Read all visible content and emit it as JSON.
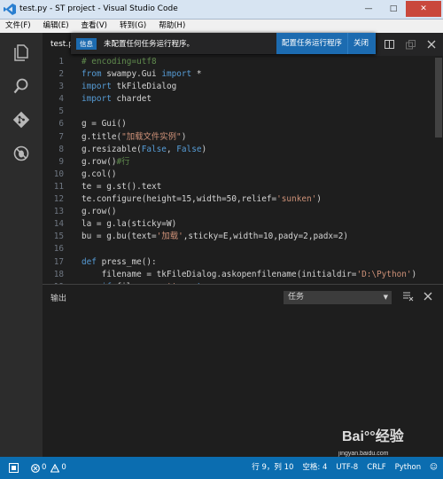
{
  "window": {
    "title": "test.py - ST project - Visual Studio Code",
    "controls": {
      "minimize": "—",
      "maximize": "□",
      "close": "✕"
    }
  },
  "menu": [
    "文件(F)",
    "编辑(E)",
    "查看(V)",
    "转到(G)",
    "帮助(H)"
  ],
  "activity": [
    "explorer-icon",
    "search-icon",
    "git-icon",
    "debug-icon"
  ],
  "tabs": [
    {
      "label": "test.p"
    }
  ],
  "notification": {
    "badge": "信息",
    "message": "未配置任何任务运行程序。",
    "action": "配置任务运行程序",
    "close": "关闭"
  },
  "code": {
    "lines": [
      {
        "n": "1",
        "segs": [
          [
            "cm",
            "# encoding=utf8"
          ]
        ]
      },
      {
        "n": "2",
        "segs": [
          [
            "kw",
            "from"
          ],
          [
            "",
            " swampy.Gui "
          ],
          [
            "kw",
            "import"
          ],
          [
            "",
            " *"
          ]
        ]
      },
      {
        "n": "3",
        "segs": [
          [
            "kw",
            "import"
          ],
          [
            "",
            " tkFileDialog"
          ]
        ]
      },
      {
        "n": "4",
        "segs": [
          [
            "kw",
            "import"
          ],
          [
            "",
            " chardet"
          ]
        ]
      },
      {
        "n": "5",
        "segs": []
      },
      {
        "n": "6",
        "segs": [
          [
            "",
            "g = Gui()"
          ]
        ]
      },
      {
        "n": "7",
        "segs": [
          [
            "",
            "g.title("
          ],
          [
            "str",
            "\"加载文件实例\""
          ],
          [
            "",
            ")"
          ]
        ]
      },
      {
        "n": "8",
        "segs": [
          [
            "",
            "g.resizable("
          ],
          [
            "kw",
            "False"
          ],
          [
            "",
            ", "
          ],
          [
            "kw",
            "False"
          ],
          [
            "",
            ")"
          ]
        ]
      },
      {
        "n": "9",
        "segs": [
          [
            "",
            "g.row()"
          ],
          [
            "cm",
            "#行"
          ]
        ]
      },
      {
        "n": "10",
        "segs": [
          [
            "",
            "g.col()"
          ]
        ]
      },
      {
        "n": "11",
        "segs": [
          [
            "",
            "te = g.st().text"
          ]
        ]
      },
      {
        "n": "12",
        "segs": [
          [
            "",
            "te.configure(height=15,width=50,relief="
          ],
          [
            "str",
            "'sunken'"
          ],
          [
            "",
            ")"
          ]
        ]
      },
      {
        "n": "13",
        "segs": [
          [
            "",
            "g.row()"
          ]
        ]
      },
      {
        "n": "14",
        "segs": [
          [
            "",
            "la = g.la(sticky=W)"
          ]
        ]
      },
      {
        "n": "15",
        "segs": [
          [
            "",
            "bu = g.bu(text="
          ],
          [
            "str",
            "'加载'"
          ],
          [
            "",
            ",sticky=E,width=10,pady=2,padx=2)"
          ]
        ]
      },
      {
        "n": "16",
        "segs": []
      },
      {
        "n": "17",
        "segs": [
          [
            "kw",
            "def"
          ],
          [
            "",
            " press_me():"
          ]
        ]
      },
      {
        "n": "18",
        "segs": [
          [
            "",
            "    filename = tkFileDialog.askopenfilename(initialdir="
          ],
          [
            "str",
            "'D:\\Python'"
          ],
          [
            "",
            ")"
          ]
        ]
      },
      {
        "n": "19",
        "segs": [
          [
            "",
            "    "
          ],
          [
            "kw",
            "if"
          ],
          [
            "",
            " filename=="
          ],
          [
            "str",
            "''"
          ],
          [
            "",
            ": "
          ],
          [
            "kw",
            "return"
          ]
        ]
      }
    ]
  },
  "panel": {
    "title": "输出",
    "select_value": "任务"
  },
  "status": {
    "errors": "0",
    "warnings": "0",
    "position": "行 9，列 10",
    "indent": "空格: 4",
    "encoding": "UTF-8",
    "eol": "CRLF",
    "language": "Python"
  },
  "watermark": {
    "logo": "Bai°°经验",
    "url": "jingyan.baidu.com"
  },
  "colors": {
    "accent": "#0b6db0",
    "editor_bg": "#1e1e1e",
    "keyword": "#569cd6",
    "string": "#ce9178",
    "comment": "#608b4e"
  }
}
